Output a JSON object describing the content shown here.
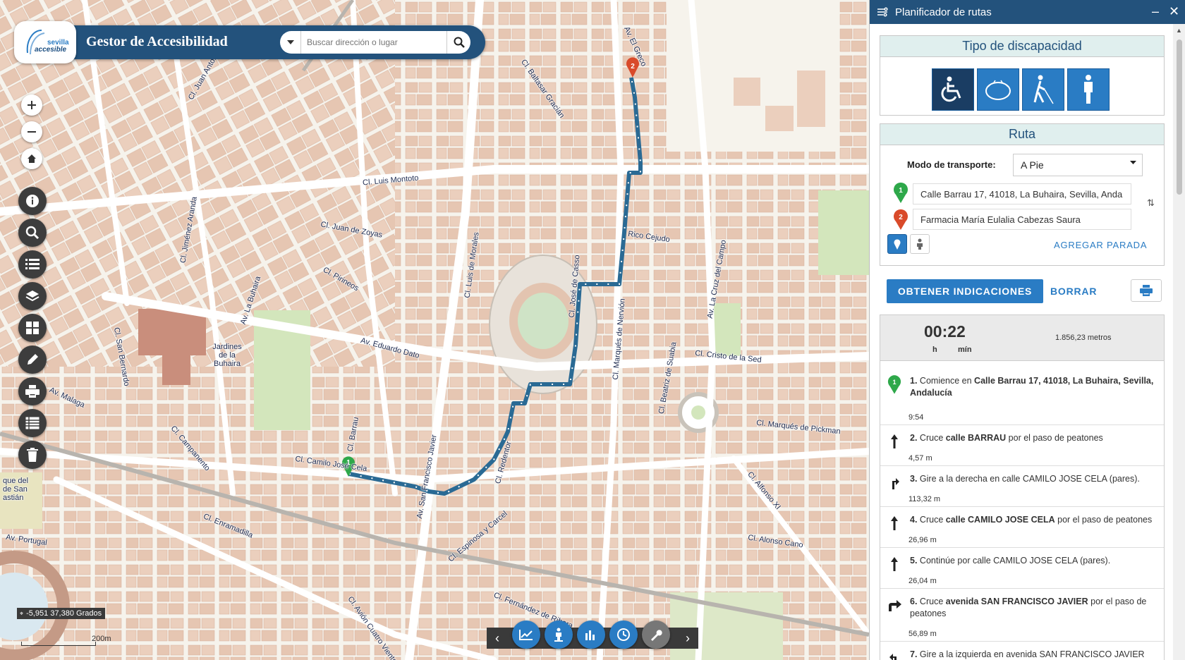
{
  "header": {
    "logo_text": "sevilla accesible",
    "title": "Gestor de Accesibilidad",
    "search_placeholder": "Buscar dirección o lugar"
  },
  "map": {
    "coordinates": "-5,951 37,380 Grados",
    "scale": "200m",
    "street_labels": [
      "Cl. Luis Montoto",
      "Cl. Juan de Zoyas",
      "Cl. Pirineos",
      "Av. Eduardo Dato",
      "Jardines de la Buhaira",
      "Cl. Camilo José Cela",
      "Rico Cejudo",
      "Cl. Cristo de la Sed",
      "Cl. Marqués de Pickman",
      "Cl. Alonso Cano",
      "Cl. Enramadilla",
      "Cl. Espinosa y Carcel",
      "Cl. Fernández de Ribera",
      "Av. Malaga",
      "Cl. Campanento",
      "Av. La Buhaira",
      "Cl. San Bernardo",
      "Cl. Baltasar Gracián",
      "Av. El Greco",
      "Cl. Luis de Morales",
      "Cl. José de Casso",
      "Cl. Marqués de Nervión",
      "Cl. Beatriz de Suabia",
      "Av. La Cruz del Campo",
      "Av. San Francisco Javier",
      "Cl. Redentor",
      "Cl. Alfonso XI",
      "Cl. Jiménez Aranda",
      "Cl. Juan Antonio",
      "Cl. Avión Cuatro Vientos",
      "Av. Portugal",
      "Cl. Barrau",
      "que del de San astián"
    ]
  },
  "panel": {
    "title": "Planificador de rutas",
    "disability_header": "Tipo de discapacidad",
    "disability_icons": [
      "wheelchair-icon",
      "hearing-icon",
      "blind-cane-icon",
      "person-icon"
    ],
    "route_header": "Ruta",
    "transport_label": "Modo de transporte:",
    "transport_value": "A Pie",
    "origin": "Calle Barrau 17, 41018, La Buhaira, Sevilla, Anda",
    "destination": "Farmacia María Eulalia Cabezas Saura",
    "origin_pin": "1",
    "dest_pin": "2",
    "add_stop": "AGREGAR PARADA",
    "get_directions": "OBTENER INDICACIONES",
    "clear": "BORRAR",
    "time": "00:22",
    "time_h": "h",
    "time_min": "mín",
    "distance": "1.856,23 metros"
  },
  "steps": [
    {
      "num": "1.",
      "icon": "start-pin",
      "html_pre": "Comience en ",
      "bold": "Calle Barrau 17, 41018, La Buhaira, Sevilla, Andalucía",
      "post": "",
      "dist": "9:54"
    },
    {
      "num": "2.",
      "icon": "straight-arrow",
      "html_pre": "Cruce ",
      "bold": "calle BARRAU",
      "post": " por el paso de peatones",
      "dist": "4,57 m"
    },
    {
      "num": "3.",
      "icon": "turn-right-arrow",
      "html_pre": "Gire a la derecha en calle CAMILO JOSE CELA (pares).",
      "bold": "",
      "post": "",
      "dist": "113,32 m"
    },
    {
      "num": "4.",
      "icon": "straight-arrow",
      "html_pre": "Cruce ",
      "bold": "calle CAMILO JOSE CELA",
      "post": " por el paso de peatones",
      "dist": "26,96 m"
    },
    {
      "num": "5.",
      "icon": "straight-arrow",
      "html_pre": "Continúe por calle CAMILO JOSE CELA (pares).",
      "bold": "",
      "post": "",
      "dist": "26,04 m"
    },
    {
      "num": "6.",
      "icon": "bear-right-arrow",
      "html_pre": "Cruce ",
      "bold": "avenida SAN FRANCISCO JAVIER",
      "post": " por el paso de peatones",
      "dist": "56,89 m"
    },
    {
      "num": "7.",
      "icon": "turn-left-arrow",
      "html_pre": "Gire a la izquierda en avenida SAN FRANCISCO JAVIER",
      "bold": "",
      "post": "",
      "dist": ""
    }
  ],
  "colors": {
    "header_blue": "#23527c",
    "accent_blue": "#2a7cc4",
    "route_blue": "#2a6a94",
    "pin_green": "#2ea84a",
    "pin_red": "#d94a2a"
  }
}
